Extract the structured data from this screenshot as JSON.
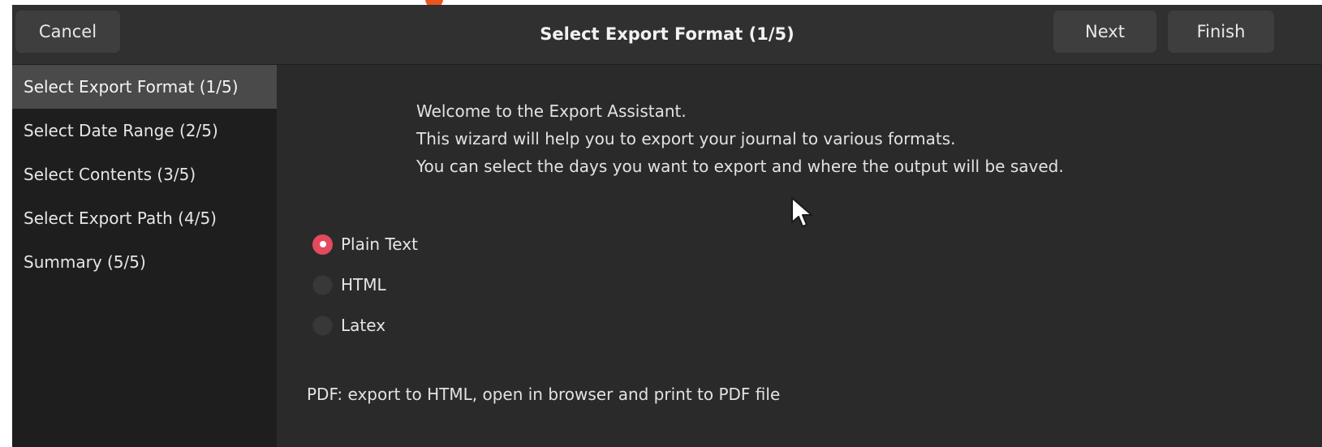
{
  "header": {
    "cancel_label": "Cancel",
    "title": "Select Export Format (1/5)",
    "next_label": "Next",
    "finish_label": "Finish"
  },
  "sidebar": {
    "items": [
      {
        "label": "Select Export Format (1/5)",
        "active": true
      },
      {
        "label": "Select Date Range (2/5)",
        "active": false
      },
      {
        "label": "Select Contents (3/5)",
        "active": false
      },
      {
        "label": "Select Export Path (4/5)",
        "active": false
      },
      {
        "label": "Summary (5/5)",
        "active": false
      }
    ]
  },
  "main": {
    "welcome_lines": [
      "Welcome to the Export Assistant.",
      "This wizard will help you to export your journal to various formats.",
      "You can select the days you want to export and where the output will be saved."
    ],
    "formats": [
      {
        "label": "Plain Text",
        "selected": true
      },
      {
        "label": "HTML",
        "selected": false
      },
      {
        "label": "Latex",
        "selected": false
      }
    ],
    "pdf_note": "PDF: export to HTML, open in browser and print to PDF file"
  },
  "colors": {
    "accent": "#e34a5d",
    "brand_orange": "#e95420",
    "sidebar_bg": "#1e1e1e",
    "content_bg": "#2a2a2a",
    "header_bg": "#303030"
  },
  "icons": {
    "pointer": "mouse-pointer-icon"
  }
}
